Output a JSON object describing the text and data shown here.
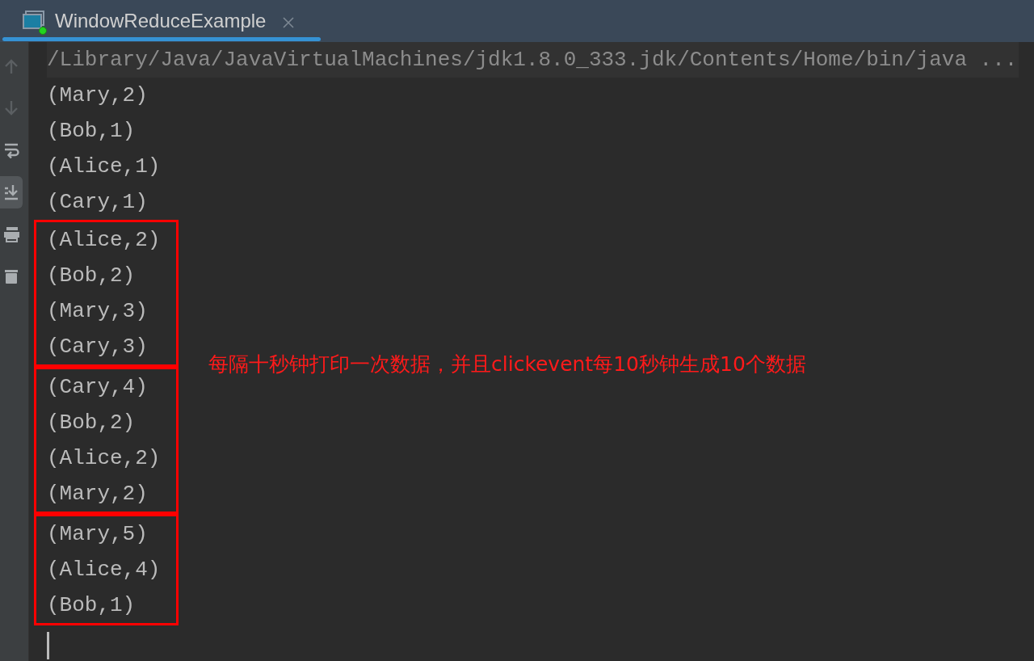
{
  "tabs": [
    {
      "label": "WindowReduceExample",
      "selected": true,
      "running": true
    }
  ],
  "toolbar": [
    {
      "kind": "up",
      "disabled": true,
      "selected": false
    },
    {
      "kind": "down",
      "disabled": true,
      "selected": false
    },
    {
      "kind": "wrap",
      "disabled": false,
      "selected": false
    },
    {
      "kind": "scroll-end",
      "disabled": false,
      "selected": true
    },
    {
      "kind": "print",
      "disabled": false,
      "selected": false
    },
    {
      "kind": "trash",
      "disabled": false,
      "selected": false
    }
  ],
  "console": {
    "command": "/Library/Java/JavaVirtualMachines/jdk1.8.0_333.jdk/Contents/Home/bin/java ...",
    "groups": [
      {
        "boxed": false,
        "lines": [
          "(Mary,2)",
          "(Bob,1)",
          "(Alice,1)",
          "(Cary,1)"
        ]
      },
      {
        "boxed": true,
        "lines": [
          "(Alice,2)",
          "(Bob,2)",
          "(Mary,3)",
          "(Cary,3)"
        ]
      },
      {
        "boxed": true,
        "lines": [
          "(Cary,4)",
          "(Bob,2)",
          "(Alice,2)",
          "(Mary,2)"
        ]
      },
      {
        "boxed": true,
        "lines": [
          "(Mary,5)",
          "(Alice,4)",
          "(Bob,1)"
        ]
      }
    ],
    "annotation": "每隔十秒钟打印一次数据，并且clickevent每10秒钟生成10个数据"
  }
}
